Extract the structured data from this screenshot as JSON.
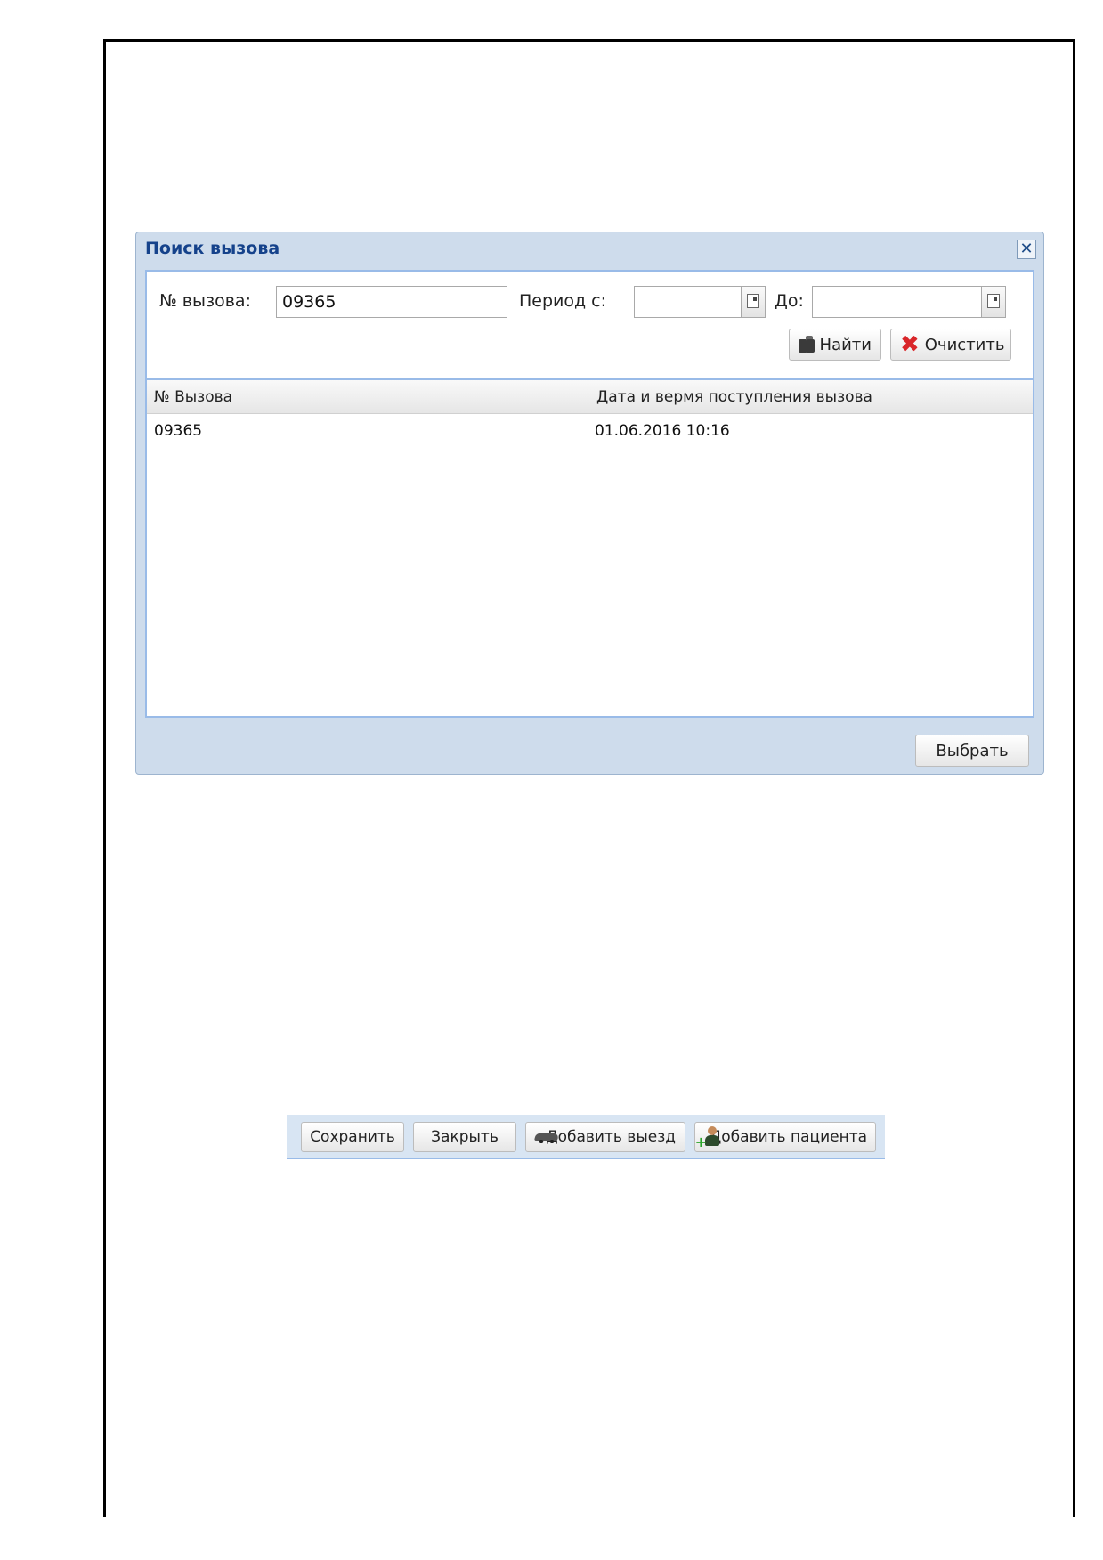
{
  "dialog": {
    "title": "Поиск вызова",
    "close_symbol": "✕",
    "filter": {
      "call_number_label": "№ вызова:",
      "call_number_value": "09365",
      "period_from_label": "Период с:",
      "period_from_value": "",
      "period_to_label": "До:",
      "period_to_value": "",
      "find_label": "Найти",
      "clear_label": "Очистить"
    },
    "grid": {
      "columns": [
        "№ Вызова",
        "Дата и вермя поступления вызова"
      ],
      "rows": [
        [
          "09365",
          "01.06.2016 10:16"
        ]
      ]
    },
    "select_label": "Выбрать"
  },
  "toolbar": {
    "save_label": "Сохранить",
    "close_label": "Закрыть",
    "add_trip_label": "Добавить выезд",
    "add_patient_label": "Добавить пациента"
  },
  "icons": {
    "find": "binoculars-icon",
    "clear": "red-x-icon",
    "calendar": "calendar-icon",
    "add_trip": "car-icon",
    "add_patient": "user-add-icon"
  },
  "colors": {
    "dialog_bg": "#cedcec",
    "title": "#15428b",
    "border": "#99bbe8",
    "clear_icon": "#d9262a"
  }
}
